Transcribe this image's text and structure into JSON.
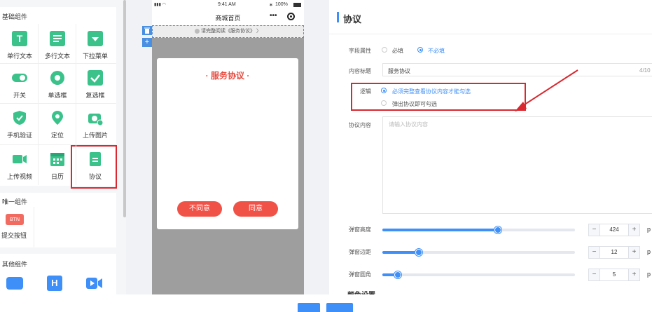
{
  "palette": {
    "sidebar_bg": "#f5f6f8",
    "component_icon": "#3ac28a",
    "accent": "#3e8ff7",
    "danger": "#f05247",
    "annotation": "#d9282f"
  },
  "left_panel": {
    "basic_section": "基础组件",
    "basic_items": [
      {
        "label": "单行文本",
        "icon": "text-t-icon"
      },
      {
        "label": "多行文本",
        "icon": "multiline-icon"
      },
      {
        "label": "下拉菜单",
        "icon": "dropdown-icon"
      },
      {
        "label": "开关",
        "icon": "toggle-icon"
      },
      {
        "label": "单选框",
        "icon": "radio-icon"
      },
      {
        "label": "复选框",
        "icon": "checkbox-icon"
      },
      {
        "label": "手机验证",
        "icon": "shield-check-icon"
      },
      {
        "label": "定位",
        "icon": "location-pin-icon"
      },
      {
        "label": "上传图片",
        "icon": "camera-icon"
      },
      {
        "label": "上传视频",
        "icon": "video-icon"
      },
      {
        "label": "日历",
        "icon": "calendar-icon"
      },
      {
        "label": "协议",
        "icon": "document-icon"
      }
    ],
    "unique_section": "唯一组件",
    "unique_items": [
      {
        "label": "提交按钮",
        "icon_text": "BTN"
      }
    ],
    "other_section": "其他组件"
  },
  "phone": {
    "time": "9:41 AM",
    "battery": "100%",
    "title": "商城首页",
    "notice": "请完整阅读《服务协议》",
    "modal_title": "· 服务协议 ·",
    "disagree": "不同意",
    "agree": "同意"
  },
  "right_panel": {
    "title": "协议",
    "field_attr_label": "字段属性",
    "required": "必填",
    "not_required": "不必填",
    "content_title_label": "内容标题",
    "content_title_value": "服务协议",
    "content_title_count": "4/10",
    "logic_label": "逻辑",
    "logic_opt1": "必须完整查看协议内容才能勾选",
    "logic_opt2": "弹出协议即可勾选",
    "agreement_label": "协议内容",
    "agreement_placeholder": "请输入协议内容",
    "sliders": [
      {
        "label": "弹窗高度",
        "value": "424",
        "unit": "p",
        "fraction": 0.6
      },
      {
        "label": "弹窗边距",
        "value": "12",
        "unit": "p",
        "fraction": 0.19
      },
      {
        "label": "弹窗圆角",
        "value": "5",
        "unit": "p",
        "fraction": 0.08
      }
    ],
    "section_cut": "颜色设置"
  }
}
